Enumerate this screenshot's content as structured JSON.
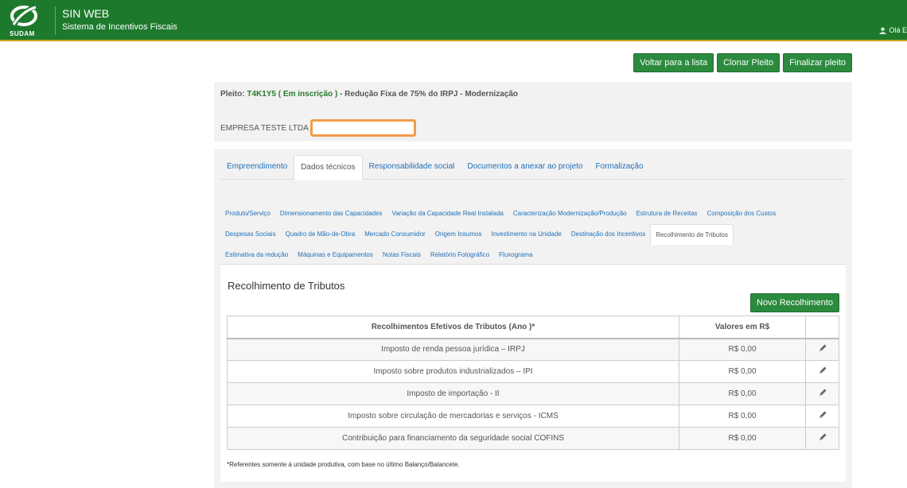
{
  "header": {
    "logo_text": "SUDAM",
    "title": "SIN WEB",
    "subtitle": "Sistema de Incentivos Fiscais",
    "user_greeting": "Olá E",
    "colors": {
      "bar": "#1d7a2c",
      "accent": "#c9a227"
    }
  },
  "actions": {
    "back": "Voltar para a lista",
    "clone": "Clonar Pleito",
    "finish": "Finalizar pleito"
  },
  "info": {
    "pleito_label": "Pleito:",
    "pleito_code": "T4K1Y5 ( Em inscrição )",
    "pleito_desc": " - Redução Fixa de 75% do IRPJ - Modernização",
    "empresa": "EMPRESA TESTE LTDA"
  },
  "tabs": [
    {
      "label": "Empreendimento",
      "active": false
    },
    {
      "label": "Dados técnicos",
      "active": true
    },
    {
      "label": "Responsabilidade social",
      "active": false
    },
    {
      "label": "Documentos a anexar ao projeto",
      "active": false
    },
    {
      "label": "Formalização",
      "active": false
    }
  ],
  "subtabs": {
    "row1": [
      "Produto/Serviço",
      "Dimensionamento das Capacidades",
      "Variação da Capacidade Real Instalada",
      "Caracterização Modernização/Produção",
      "Estrutura de Receitas",
      "Composição dos Custos"
    ],
    "row2": [
      "Despesas Sociais",
      "Quadro de Mão-de-Obra",
      "Mercado Consumidor",
      "Origem Insumos",
      "Investimento na Unidade",
      "Destinação dos Incentivos",
      "Recolhimento de Tributos"
    ],
    "row3": [
      "Estimativa da redução",
      "Máquinas e Equipamentos",
      "Notas Fiscais",
      "Relatório Fotográfico",
      "Fluxograma"
    ],
    "active": "Recolhimento de Tributos"
  },
  "content": {
    "title": "Recolhimento de Tributos",
    "new_button": "Novo Recolhimento",
    "table": {
      "headers": [
        "Recolhimentos Efetivos de Tributos (Ano )*",
        "Valores em R$"
      ],
      "rows": [
        {
          "tributo": "Imposto de renda pessoa jurídica – IRPJ",
          "valor": "R$ 0,00"
        },
        {
          "tributo": "Imposto sobre produtos industrializados – IPI",
          "valor": "R$ 0,00"
        },
        {
          "tributo": "Imposto de importação - II",
          "valor": "R$ 0,00"
        },
        {
          "tributo": "Imposto sobre circulação de mercadorias e serviços - ICMS",
          "valor": "R$ 0,00"
        },
        {
          "tributo": "Contribuição para financiamento da seguridade social COFINS",
          "valor": "R$ 0,00"
        }
      ]
    },
    "footnote": "*Referentes somente à unidade produtiva, com base no último Balanço/Balancete."
  }
}
